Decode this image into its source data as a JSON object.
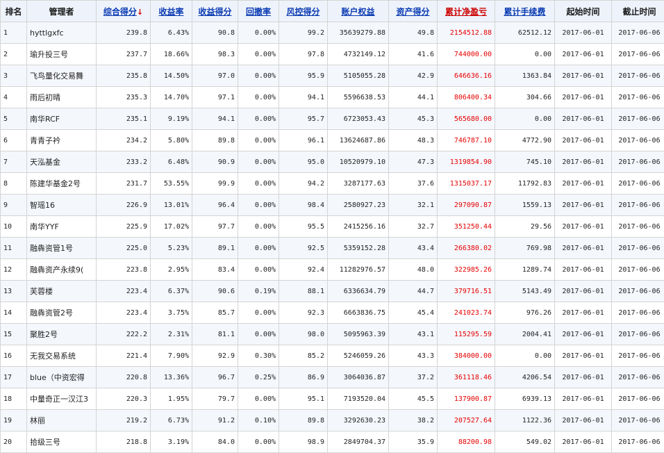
{
  "headers": {
    "rank": "排名",
    "manager": "管理者",
    "score": "综合得分",
    "sort_arrow": "↓",
    "return_rate": "收益率",
    "return_score": "收益得分",
    "drawdown": "回撤率",
    "risk_score": "风控得分",
    "equity": "账户权益",
    "asset_score": "资产得分",
    "cum_pnl": "累计净盈亏",
    "cum_fee": "累计手续费",
    "start": "起始时间",
    "end": "截止时间"
  },
  "colors": {
    "link": "#0b3bb3",
    "profit": "#e60000",
    "header_bg": "#eef3fb"
  },
  "rows": [
    {
      "rank": "1",
      "name": "hyttlgxfc",
      "score": "239.8",
      "ret": "6.43%",
      "ret_score": "90.8",
      "dd": "0.00%",
      "risk": "99.2",
      "equity": "35639279.88",
      "asset": "49.8",
      "pnl": "2154512.88",
      "fee": "62512.12",
      "start": "2017-06-01",
      "end": "2017-06-06"
    },
    {
      "rank": "2",
      "name": "瑜升投三号",
      "score": "237.7",
      "ret": "18.66%",
      "ret_score": "98.3",
      "dd": "0.00%",
      "risk": "97.8",
      "equity": "4732149.12",
      "asset": "41.6",
      "pnl": "744000.00",
      "fee": "0.00",
      "start": "2017-06-01",
      "end": "2017-06-06"
    },
    {
      "rank": "3",
      "name": "飞鸟量化交易舞",
      "score": "235.8",
      "ret": "14.50%",
      "ret_score": "97.0",
      "dd": "0.00%",
      "risk": "95.9",
      "equity": "5105055.28",
      "asset": "42.9",
      "pnl": "646636.16",
      "fee": "1363.84",
      "start": "2017-06-01",
      "end": "2017-06-06"
    },
    {
      "rank": "4",
      "name": "雨后初晴",
      "score": "235.3",
      "ret": "14.70%",
      "ret_score": "97.1",
      "dd": "0.00%",
      "risk": "94.1",
      "equity": "5596638.53",
      "asset": "44.1",
      "pnl": "806400.34",
      "fee": "304.66",
      "start": "2017-06-01",
      "end": "2017-06-06"
    },
    {
      "rank": "5",
      "name": "南华RCF",
      "score": "235.1",
      "ret": "9.19%",
      "ret_score": "94.1",
      "dd": "0.00%",
      "risk": "95.7",
      "equity": "6723053.43",
      "asset": "45.3",
      "pnl": "565680.00",
      "fee": "0.00",
      "start": "2017-06-01",
      "end": "2017-06-06"
    },
    {
      "rank": "6",
      "name": "青青子衿",
      "score": "234.2",
      "ret": "5.80%",
      "ret_score": "89.8",
      "dd": "0.00%",
      "risk": "96.1",
      "equity": "13624687.86",
      "asset": "48.3",
      "pnl": "746787.10",
      "fee": "4772.90",
      "start": "2017-06-01",
      "end": "2017-06-06"
    },
    {
      "rank": "7",
      "name": "天泓基金",
      "score": "233.2",
      "ret": "6.48%",
      "ret_score": "90.9",
      "dd": "0.00%",
      "risk": "95.0",
      "equity": "10520979.10",
      "asset": "47.3",
      "pnl": "1319854.90",
      "fee": "745.10",
      "start": "2017-06-01",
      "end": "2017-06-06"
    },
    {
      "rank": "8",
      "name": "陈建华基金2号",
      "score": "231.7",
      "ret": "53.55%",
      "ret_score": "99.9",
      "dd": "0.00%",
      "risk": "94.2",
      "equity": "3287177.63",
      "asset": "37.6",
      "pnl": "1315037.17",
      "fee": "11792.83",
      "start": "2017-06-01",
      "end": "2017-06-06"
    },
    {
      "rank": "9",
      "name": "智瑶16",
      "score": "226.9",
      "ret": "13.01%",
      "ret_score": "96.4",
      "dd": "0.00%",
      "risk": "98.4",
      "equity": "2580927.23",
      "asset": "32.1",
      "pnl": "297090.87",
      "fee": "1559.13",
      "start": "2017-06-01",
      "end": "2017-06-06"
    },
    {
      "rank": "10",
      "name": "南华YYF",
      "score": "225.9",
      "ret": "17.02%",
      "ret_score": "97.7",
      "dd": "0.00%",
      "risk": "95.5",
      "equity": "2415256.16",
      "asset": "32.7",
      "pnl": "351250.44",
      "fee": "29.56",
      "start": "2017-06-01",
      "end": "2017-06-06"
    },
    {
      "rank": "11",
      "name": "融犇资管1号",
      "score": "225.0",
      "ret": "5.23%",
      "ret_score": "89.1",
      "dd": "0.00%",
      "risk": "92.5",
      "equity": "5359152.28",
      "asset": "43.4",
      "pnl": "266380.02",
      "fee": "769.98",
      "start": "2017-06-01",
      "end": "2017-06-06"
    },
    {
      "rank": "12",
      "name": "融犇资产永续9(",
      "score": "223.8",
      "ret": "2.95%",
      "ret_score": "83.4",
      "dd": "0.00%",
      "risk": "92.4",
      "equity": "11282976.57",
      "asset": "48.0",
      "pnl": "322985.26",
      "fee": "1289.74",
      "start": "2017-06-01",
      "end": "2017-06-06"
    },
    {
      "rank": "13",
      "name": "芙蓉楼",
      "score": "223.4",
      "ret": "6.37%",
      "ret_score": "90.6",
      "dd": "0.19%",
      "risk": "88.1",
      "equity": "6336634.79",
      "asset": "44.7",
      "pnl": "379716.51",
      "fee": "5143.49",
      "start": "2017-06-01",
      "end": "2017-06-06"
    },
    {
      "rank": "14",
      "name": "融犇资管2号",
      "score": "223.4",
      "ret": "3.75%",
      "ret_score": "85.7",
      "dd": "0.00%",
      "risk": "92.3",
      "equity": "6663836.75",
      "asset": "45.4",
      "pnl": "241023.74",
      "fee": "976.26",
      "start": "2017-06-01",
      "end": "2017-06-06"
    },
    {
      "rank": "15",
      "name": "聚胜2号",
      "score": "222.2",
      "ret": "2.31%",
      "ret_score": "81.1",
      "dd": "0.00%",
      "risk": "98.0",
      "equity": "5095963.39",
      "asset": "43.1",
      "pnl": "115295.59",
      "fee": "2004.41",
      "start": "2017-06-01",
      "end": "2017-06-06"
    },
    {
      "rank": "16",
      "name": "无我交易系统",
      "score": "221.4",
      "ret": "7.90%",
      "ret_score": "92.9",
      "dd": "0.30%",
      "risk": "85.2",
      "equity": "5246059.26",
      "asset": "43.3",
      "pnl": "384000.00",
      "fee": "0.00",
      "start": "2017-06-01",
      "end": "2017-06-06"
    },
    {
      "rank": "17",
      "name": "blue（中资宏得",
      "score": "220.8",
      "ret": "13.36%",
      "ret_score": "96.7",
      "dd": "0.25%",
      "risk": "86.9",
      "equity": "3064036.87",
      "asset": "37.2",
      "pnl": "361118.46",
      "fee": "4206.54",
      "start": "2017-06-01",
      "end": "2017-06-06"
    },
    {
      "rank": "18",
      "name": "中量奇正一汉江3",
      "score": "220.3",
      "ret": "1.95%",
      "ret_score": "79.7",
      "dd": "0.00%",
      "risk": "95.1",
      "equity": "7193520.04",
      "asset": "45.5",
      "pnl": "137900.87",
      "fee": "6939.13",
      "start": "2017-06-01",
      "end": "2017-06-06"
    },
    {
      "rank": "19",
      "name": "林丽",
      "score": "219.2",
      "ret": "6.73%",
      "ret_score": "91.2",
      "dd": "0.10%",
      "risk": "89.8",
      "equity": "3292630.23",
      "asset": "38.2",
      "pnl": "207527.64",
      "fee": "1122.36",
      "start": "2017-06-01",
      "end": "2017-06-06"
    },
    {
      "rank": "20",
      "name": "拾级三号",
      "score": "218.8",
      "ret": "3.19%",
      "ret_score": "84.0",
      "dd": "0.00%",
      "risk": "98.9",
      "equity": "2849704.37",
      "asset": "35.9",
      "pnl": "88200.98",
      "fee": "549.02",
      "start": "2017-06-01",
      "end": "2017-06-06"
    }
  ]
}
